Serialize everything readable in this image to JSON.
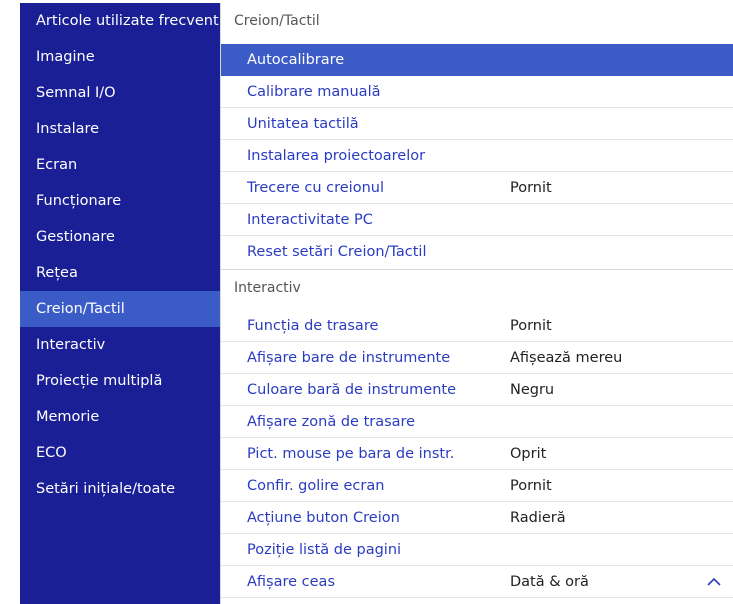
{
  "sidebar": {
    "items": [
      {
        "label": "Articole utilizate frecvent"
      },
      {
        "label": "Imagine"
      },
      {
        "label": "Semnal I/O"
      },
      {
        "label": "Instalare"
      },
      {
        "label": "Ecran"
      },
      {
        "label": "Funcționare"
      },
      {
        "label": "Gestionare"
      },
      {
        "label": "Rețea"
      },
      {
        "label": "Creion/Tactil",
        "active": true
      },
      {
        "label": "Interactiv"
      },
      {
        "label": "Proiecție multiplă"
      },
      {
        "label": "Memorie"
      },
      {
        "label": "ECO"
      },
      {
        "label": "Setări inițiale/toate"
      }
    ]
  },
  "main": {
    "section1": {
      "title": "Creion/Tactil",
      "rows": [
        {
          "label": "Autocalibrare",
          "value": "",
          "selected": true
        },
        {
          "label": "Calibrare manuală",
          "value": ""
        },
        {
          "label": "Unitatea tactilă",
          "value": ""
        },
        {
          "label": "Instalarea proiectoarelor",
          "value": ""
        },
        {
          "label": "Trecere cu creionul",
          "value": "Pornit"
        },
        {
          "label": "Interactivitate PC",
          "value": ""
        },
        {
          "label": "Reset setări Creion/Tactil",
          "value": ""
        }
      ]
    },
    "section2": {
      "title": "Interactiv",
      "rows": [
        {
          "label": "Funcția de trasare",
          "value": "Pornit"
        },
        {
          "label": "Afișare bare de instrumente",
          "value": "Afișează mereu"
        },
        {
          "label": "Culoare bară de instrumente",
          "value": "Negru"
        },
        {
          "label": "Afișare zonă de trasare",
          "value": ""
        },
        {
          "label": "Pict. mouse pe bara de instr.",
          "value": "Oprit"
        },
        {
          "label": "Confir. golire ecran",
          "value": "Pornit"
        },
        {
          "label": "Acțiune buton Creion",
          "value": "Radieră"
        },
        {
          "label": "Poziție listă de pagini",
          "value": ""
        },
        {
          "label": "Afișare ceas",
          "value": "Dată & oră",
          "scroll_icon": "chevron-up-icon"
        }
      ]
    }
  },
  "colors": {
    "sidebar_bg": "#1a1f96",
    "highlight": "#3b5cc6",
    "menu_text": "#2a3cc2"
  }
}
